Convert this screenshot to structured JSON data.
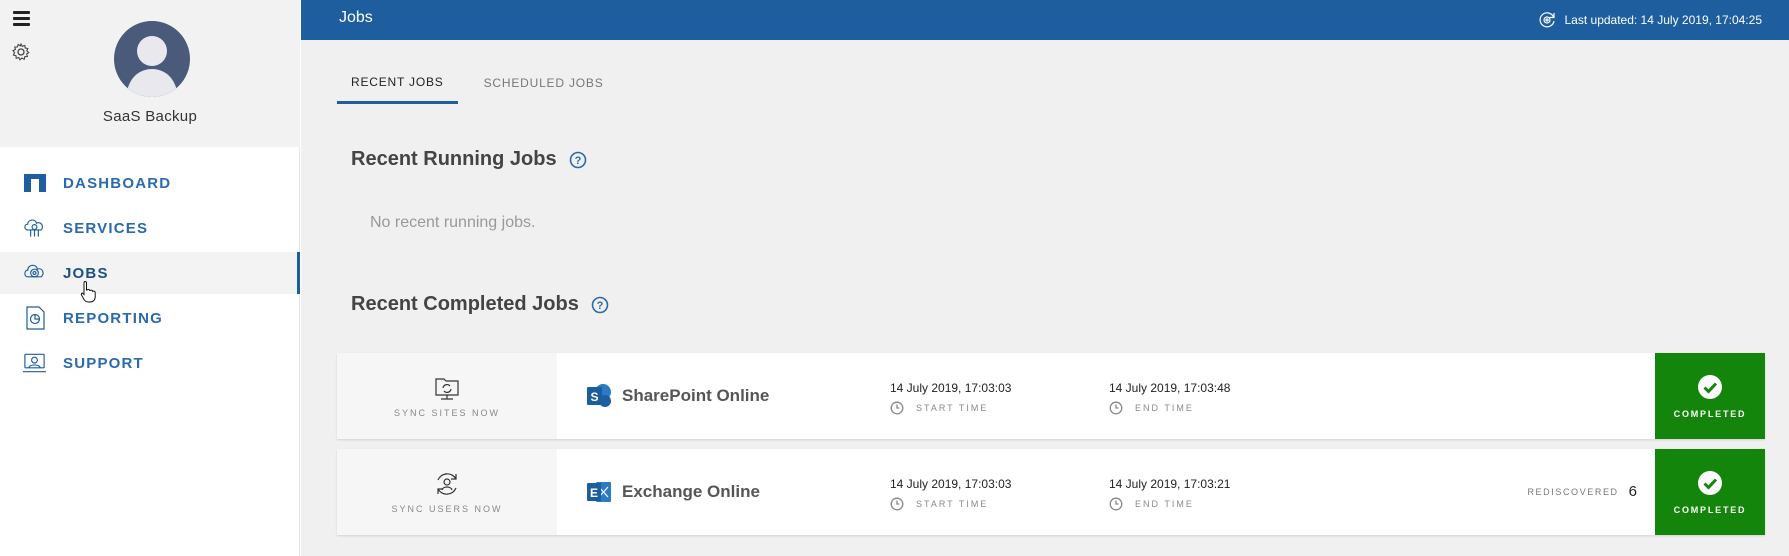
{
  "sidebar": {
    "org_name": "SaaS Backup",
    "nav": [
      {
        "label": "DASHBOARD",
        "icon": "dashboard-icon"
      },
      {
        "label": "SERVICES",
        "icon": "services-icon"
      },
      {
        "label": "JOBS",
        "icon": "jobs-icon",
        "active": true
      },
      {
        "label": "REPORTING",
        "icon": "reporting-icon"
      },
      {
        "label": "SUPPORT",
        "icon": "support-icon"
      }
    ]
  },
  "header": {
    "title": "Jobs",
    "last_updated": "Last updated: 14 July 2019, 17:04:25"
  },
  "tabs": [
    {
      "label": "RECENT JOBS",
      "active": true
    },
    {
      "label": "SCHEDULED JOBS",
      "active": false
    }
  ],
  "running": {
    "title": "Recent Running Jobs",
    "empty_message": "No recent running jobs."
  },
  "completed": {
    "title": "Recent Completed Jobs",
    "jobs": [
      {
        "sync_label": "SYNC SITES NOW",
        "service": "SharePoint Online",
        "start_time": "14 July 2019, 17:03:03",
        "start_label": "START TIME",
        "end_time": "14 July 2019, 17:03:48",
        "end_label": "END TIME",
        "status": "COMPLETED"
      },
      {
        "sync_label": "SYNC USERS NOW",
        "service": "Exchange Online",
        "start_time": "14 July 2019, 17:03:03",
        "start_label": "START TIME",
        "end_time": "14 July 2019, 17:03:21",
        "end_label": "END TIME",
        "rediscovered_label": "REDISCOVERED",
        "rediscovered_value": "6",
        "status": "COMPLETED"
      }
    ]
  },
  "colors": {
    "header_blue": "#1e5d9e",
    "nav_blue": "#2a6aad",
    "status_green": "#13850a"
  }
}
